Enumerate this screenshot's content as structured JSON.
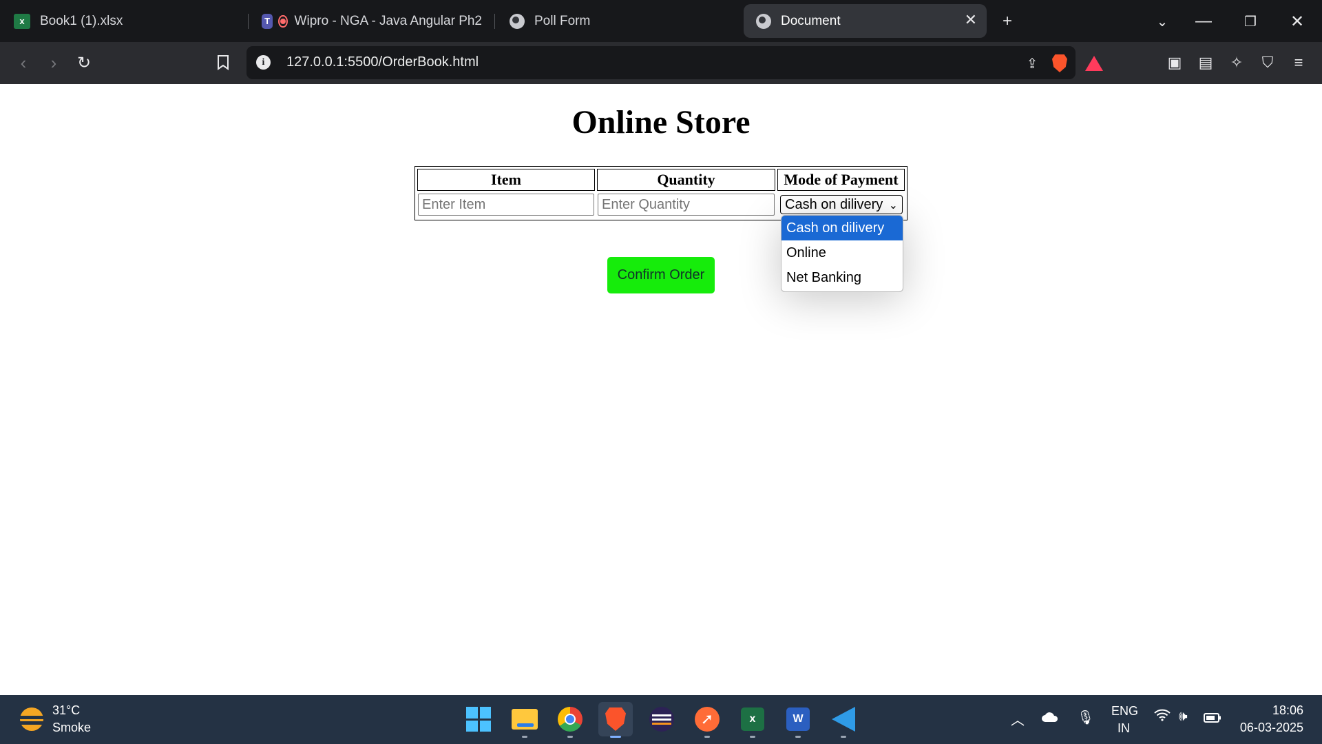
{
  "browser": {
    "tabs": [
      {
        "label": "Book1 (1).xlsx",
        "icon": "excel-icon",
        "active": false
      },
      {
        "label": "Wipro - NGA - Java Angular Ph2",
        "icon": "teams-icon",
        "active": false
      },
      {
        "label": "Poll Form",
        "icon": "globe-icon",
        "active": false
      },
      {
        "label": "Document",
        "icon": "globe-icon",
        "active": true
      }
    ],
    "new_tab_glyph": "+",
    "tab_close_glyph": "✕",
    "url": "127.0.0.1:5500/OrderBook.html",
    "info_glyph": "i"
  },
  "page": {
    "title": "Online Store",
    "table": {
      "headers": [
        "Item",
        "Quantity",
        "Mode of Payment"
      ],
      "item_placeholder": "Enter Item",
      "quantity_placeholder": "Enter Quantity",
      "payment_selected": "Cash on dilivery",
      "payment_options": [
        "Cash on dilivery",
        "Online",
        "Net Banking"
      ]
    },
    "confirm_button": "Confirm Order"
  },
  "taskbar": {
    "weather": {
      "temp": "31°C",
      "condition": "Smoke"
    },
    "language": {
      "line1": "ENG",
      "line2": "IN"
    },
    "clock": {
      "time": "18:06",
      "date": "06-03-2025"
    },
    "apps": [
      "start-icon",
      "file-explorer-icon",
      "chrome-icon",
      "brave-icon",
      "eclipse-icon",
      "postman-icon",
      "excel-icon",
      "word-icon",
      "vscode-icon"
    ]
  },
  "colors": {
    "confirm_button_bg": "#16ec0b",
    "selected_option_bg": "#1a69d4",
    "tabbar_bg": "#17181b",
    "toolbar_bg": "#2b2c30",
    "taskbar_bg": "#243244"
  }
}
